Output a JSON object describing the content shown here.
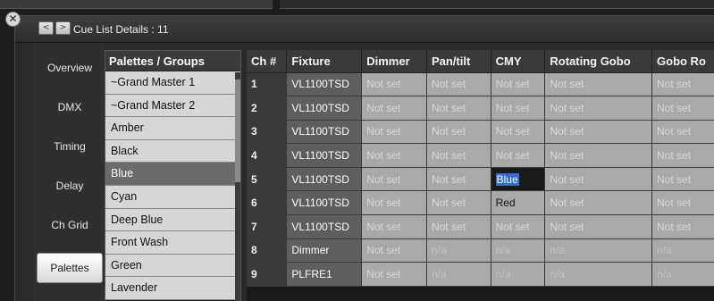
{
  "window": {
    "title": "Cue List Details : 11",
    "close_label": "✕",
    "back_label": "<",
    "forward_label": ">"
  },
  "side_tabs": [
    {
      "label": "Overview",
      "active": false
    },
    {
      "label": "DMX",
      "active": false
    },
    {
      "label": "Timing",
      "active": false
    },
    {
      "label": "Delay",
      "active": false
    },
    {
      "label": "Ch Grid",
      "active": false
    },
    {
      "label": "Palettes",
      "active": true
    }
  ],
  "palettes": {
    "header": "Palettes / Groups",
    "items": [
      {
        "label": "~Grand Master 1",
        "selected": false
      },
      {
        "label": "~Grand Master 2",
        "selected": false
      },
      {
        "label": "Amber",
        "selected": false
      },
      {
        "label": "Black",
        "selected": false
      },
      {
        "label": "Blue",
        "selected": true
      },
      {
        "label": "Cyan",
        "selected": false
      },
      {
        "label": "Deep Blue",
        "selected": false
      },
      {
        "label": "Front Wash",
        "selected": false
      },
      {
        "label": "Green",
        "selected": false
      },
      {
        "label": "Lavender",
        "selected": false
      }
    ]
  },
  "grid": {
    "columns": [
      "Ch #",
      "Fixture",
      "Dimmer",
      "Pan/tilt",
      "CMY",
      "Rotating Gobo",
      "Gobo Ro"
    ],
    "rows": [
      {
        "ch": "1",
        "fixture": "VL1100TSD",
        "cells": [
          "Not set",
          "Not set",
          "Not set",
          "Not set",
          "Not set"
        ]
      },
      {
        "ch": "2",
        "fixture": "VL1100TSD",
        "cells": [
          "Not set",
          "Not set",
          "Not set",
          "Not set",
          "Not set"
        ]
      },
      {
        "ch": "3",
        "fixture": "VL1100TSD",
        "cells": [
          "Not set",
          "Not set",
          "Not set",
          "Not set",
          "Not set"
        ]
      },
      {
        "ch": "4",
        "fixture": "VL1100TSD",
        "cells": [
          "Not set",
          "Not set",
          "Not set",
          "Not set",
          "Not set"
        ]
      },
      {
        "ch": "5",
        "fixture": "VL1100TSD",
        "cells": [
          "Not set",
          "Not set",
          "Blue",
          "Not set",
          "Not set"
        ]
      },
      {
        "ch": "6",
        "fixture": "VL1100TSD",
        "cells": [
          "Not set",
          "Not set",
          "Red",
          "Not set",
          "Not set"
        ]
      },
      {
        "ch": "7",
        "fixture": "VL1100TSD",
        "cells": [
          "Not set",
          "Not set",
          "Not set",
          "Not set",
          "Not set"
        ]
      },
      {
        "ch": "8",
        "fixture": "Dimmer",
        "cells": [
          "Not set",
          "n/a",
          "n/a",
          "n/a",
          "n/a"
        ]
      },
      {
        "ch": "9",
        "fixture": "PLFRE1",
        "cells": [
          "Not set",
          "n/a",
          "n/a",
          "n/a",
          "n/a"
        ]
      }
    ],
    "selected_cell": {
      "row": 4,
      "col": 2
    }
  }
}
